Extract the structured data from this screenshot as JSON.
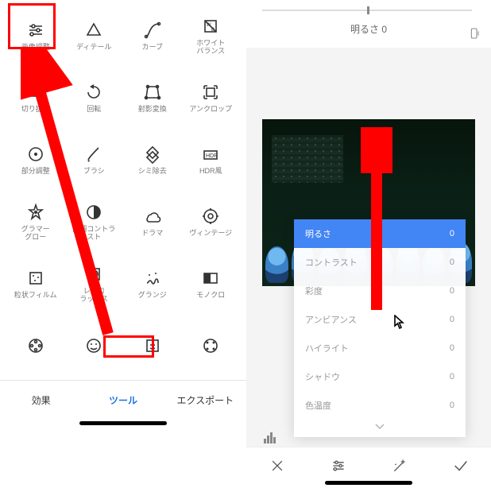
{
  "left": {
    "tools": [
      {
        "id": "tune-image",
        "label": "画像調整"
      },
      {
        "id": "details",
        "label": "ディテール"
      },
      {
        "id": "curves",
        "label": "カーブ"
      },
      {
        "id": "white-balance",
        "label": "ホワイト\nバランス"
      },
      {
        "id": "crop",
        "label": "切り抜き"
      },
      {
        "id": "rotate",
        "label": "回転"
      },
      {
        "id": "perspective",
        "label": "射影変換"
      },
      {
        "id": "expand",
        "label": "アンクロップ"
      },
      {
        "id": "selective",
        "label": "部分調整"
      },
      {
        "id": "brush",
        "label": "ブラシ"
      },
      {
        "id": "healing",
        "label": "シミ除去"
      },
      {
        "id": "hdr",
        "label": "HDR風"
      },
      {
        "id": "glamour-glow",
        "label": "グラマー\nグロー"
      },
      {
        "id": "tonal-contrast",
        "label": "階調コントラ\nスト"
      },
      {
        "id": "drama",
        "label": "ドラマ"
      },
      {
        "id": "vintage",
        "label": "ヴィンテージ"
      },
      {
        "id": "grainy-film",
        "label": "粒状フィルム"
      },
      {
        "id": "retrolux",
        "label": "レトロ\nラックス"
      },
      {
        "id": "grunge",
        "label": "グランジ"
      },
      {
        "id": "bw",
        "label": "モノクロ"
      }
    ],
    "extra_row": [
      {
        "id": "film-reel",
        "label": ""
      },
      {
        "id": "face",
        "label": ""
      },
      {
        "id": "face-box",
        "label": ""
      },
      {
        "id": "dots",
        "label": ""
      }
    ],
    "tabs": {
      "styles": "効果",
      "tools": "ツール",
      "export": "エクスポート"
    }
  },
  "right": {
    "readout_label": "明るさ",
    "readout_value": "0",
    "params": [
      {
        "id": "brightness",
        "label": "明るさ",
        "value": "0",
        "active": true
      },
      {
        "id": "contrast",
        "label": "コントラスト",
        "value": "0"
      },
      {
        "id": "saturation",
        "label": "彩度",
        "value": "0"
      },
      {
        "id": "ambiance",
        "label": "アンビアンス",
        "value": "0"
      },
      {
        "id": "highlights",
        "label": "ハイライト",
        "value": "0"
      },
      {
        "id": "shadows",
        "label": "シャドウ",
        "value": "0"
      },
      {
        "id": "warmth",
        "label": "色温度",
        "value": "0"
      }
    ],
    "buttons": {
      "cancel": "×",
      "adjust": "≡",
      "auto": "✧",
      "apply": "✓"
    }
  }
}
